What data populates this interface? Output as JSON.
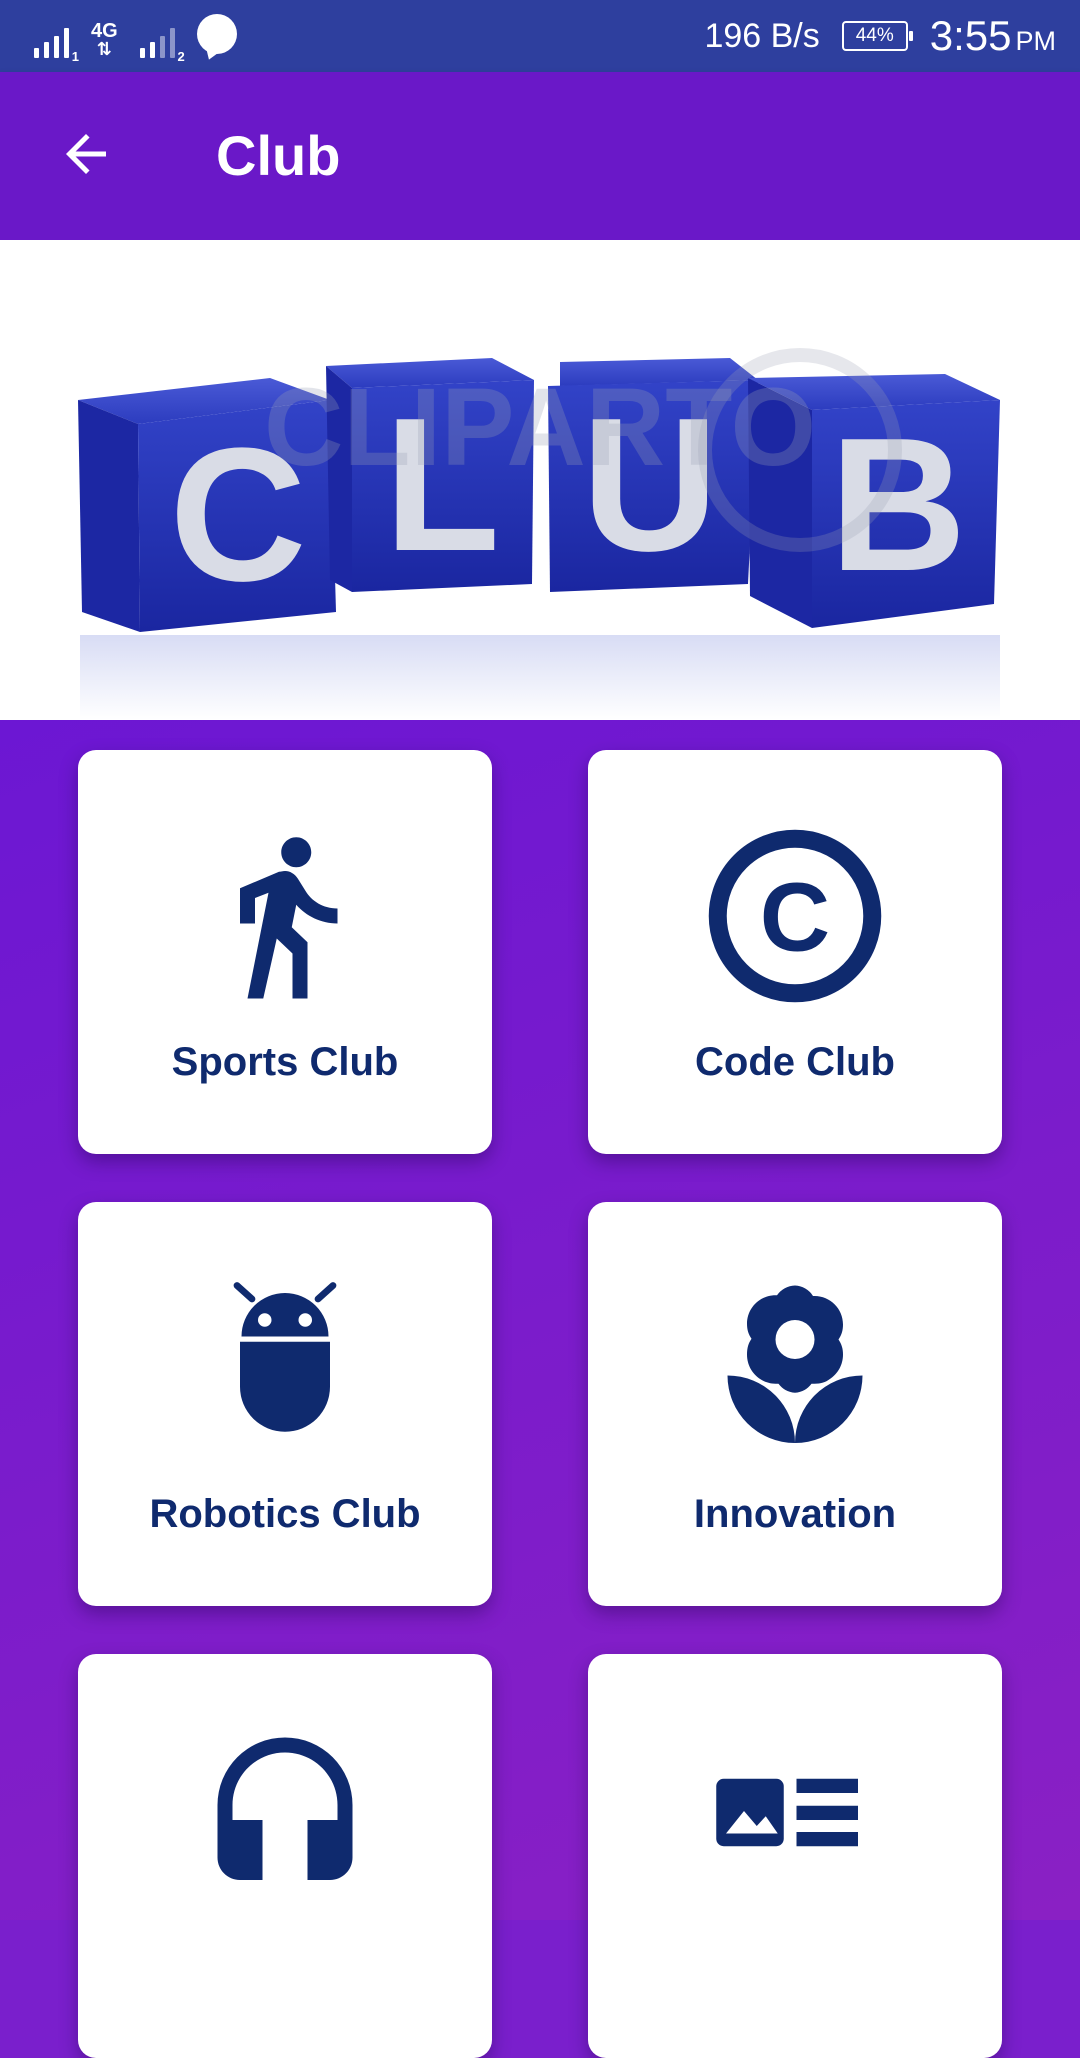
{
  "status_bar": {
    "network_type": "4G",
    "sim1_index": "1",
    "sim2_index": "2",
    "data_speed": "196 B/s",
    "battery": "44%",
    "time": "3:55",
    "ampm": "PM"
  },
  "app_bar": {
    "title": "Club",
    "back_icon": "arrow-back-icon"
  },
  "banner": {
    "letters": [
      "C",
      "L",
      "U",
      "B"
    ],
    "watermark": "CLIPARTO",
    "cube_color": "#2433b8"
  },
  "clubs": [
    {
      "label": "Sports Club",
      "icon": "walking-person-icon"
    },
    {
      "label": "Code Club",
      "icon": "copyright-icon"
    },
    {
      "label": "Robotics Club",
      "icon": "android-icon"
    },
    {
      "label": "Innovation",
      "icon": "flower-icon"
    },
    {
      "label": "",
      "icon": "headphones-icon"
    },
    {
      "label": "",
      "icon": "article-icon"
    }
  ],
  "colors": {
    "status_bar": "#2e3f9e",
    "app_bar": "#6a18c8",
    "background": "#7a1fcc",
    "icon": "#0f2a6e"
  }
}
